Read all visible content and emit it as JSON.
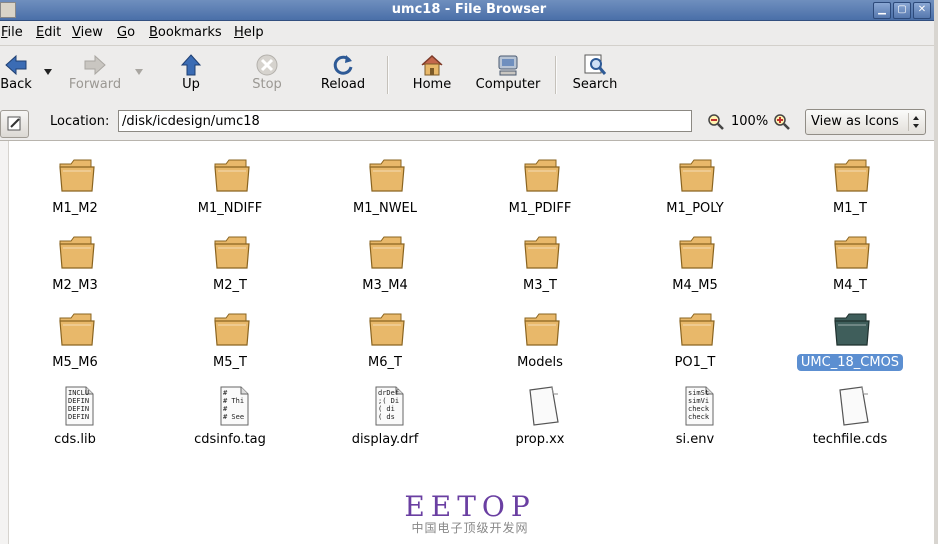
{
  "window": {
    "title": "umc18 - File Browser",
    "minimize": "▁",
    "maximize": "▢",
    "close": "✕"
  },
  "menu": [
    {
      "first": "F",
      "rest": "ile"
    },
    {
      "first": "E",
      "rest": "dit"
    },
    {
      "first": "V",
      "rest": "iew"
    },
    {
      "first": "G",
      "rest": "o"
    },
    {
      "first": "B",
      "rest": "ookmarks"
    },
    {
      "first": "H",
      "rest": "elp"
    }
  ],
  "toolbar": {
    "back": "Back",
    "forward": "Forward",
    "up": "Up",
    "stop": "Stop",
    "reload": "Reload",
    "home": "Home",
    "computer": "Computer",
    "search": "Search"
  },
  "location": {
    "label": "Location:",
    "value": "/disk/icdesign/umc18",
    "zoom": "100%",
    "view_mode": "View as Icons"
  },
  "files": [
    {
      "name": "M1_M2",
      "kind": "folder"
    },
    {
      "name": "M1_NDIFF",
      "kind": "folder"
    },
    {
      "name": "M1_NWEL",
      "kind": "folder"
    },
    {
      "name": "M1_PDIFF",
      "kind": "folder"
    },
    {
      "name": "M1_POLY",
      "kind": "folder"
    },
    {
      "name": "M1_T",
      "kind": "folder"
    },
    {
      "name": "M2_M3",
      "kind": "folder"
    },
    {
      "name": "M2_T",
      "kind": "folder"
    },
    {
      "name": "M3_M4",
      "kind": "folder"
    },
    {
      "name": "M3_T",
      "kind": "folder"
    },
    {
      "name": "M4_M5",
      "kind": "folder"
    },
    {
      "name": "M4_T",
      "kind": "folder"
    },
    {
      "name": "M5_M6",
      "kind": "folder"
    },
    {
      "name": "M5_T",
      "kind": "folder"
    },
    {
      "name": "M6_T",
      "kind": "folder"
    },
    {
      "name": "Models",
      "kind": "folder"
    },
    {
      "name": "PO1_T",
      "kind": "folder"
    },
    {
      "name": "UMC_18_CMOS",
      "kind": "folder",
      "selected": true
    },
    {
      "name": "cds.lib",
      "kind": "text",
      "preview": [
        "INCLU",
        "DEFIN",
        "DEFIN",
        "DEFIN"
      ]
    },
    {
      "name": "cdsinfo.tag",
      "kind": "text",
      "preview": [
        "#",
        "# Thi",
        "#",
        "# See"
      ]
    },
    {
      "name": "display.drf",
      "kind": "text",
      "preview": [
        "drDef",
        ";( Di",
        " ( di",
        " ( ds"
      ]
    },
    {
      "name": "prop.xx",
      "kind": "blank"
    },
    {
      "name": "si.env",
      "kind": "text",
      "preview": [
        "simSt",
        "simVi",
        "check",
        "check"
      ]
    },
    {
      "name": "techfile.cds",
      "kind": "blank"
    }
  ],
  "watermark": {
    "title": "EETOP",
    "subtitle": "中国电子顶级开发网"
  },
  "colors": {
    "folder": "#e8b86a",
    "selected_folder": "#3f5e5b",
    "selection": "#5c8fd1",
    "titlebar": "#5a7db3"
  }
}
